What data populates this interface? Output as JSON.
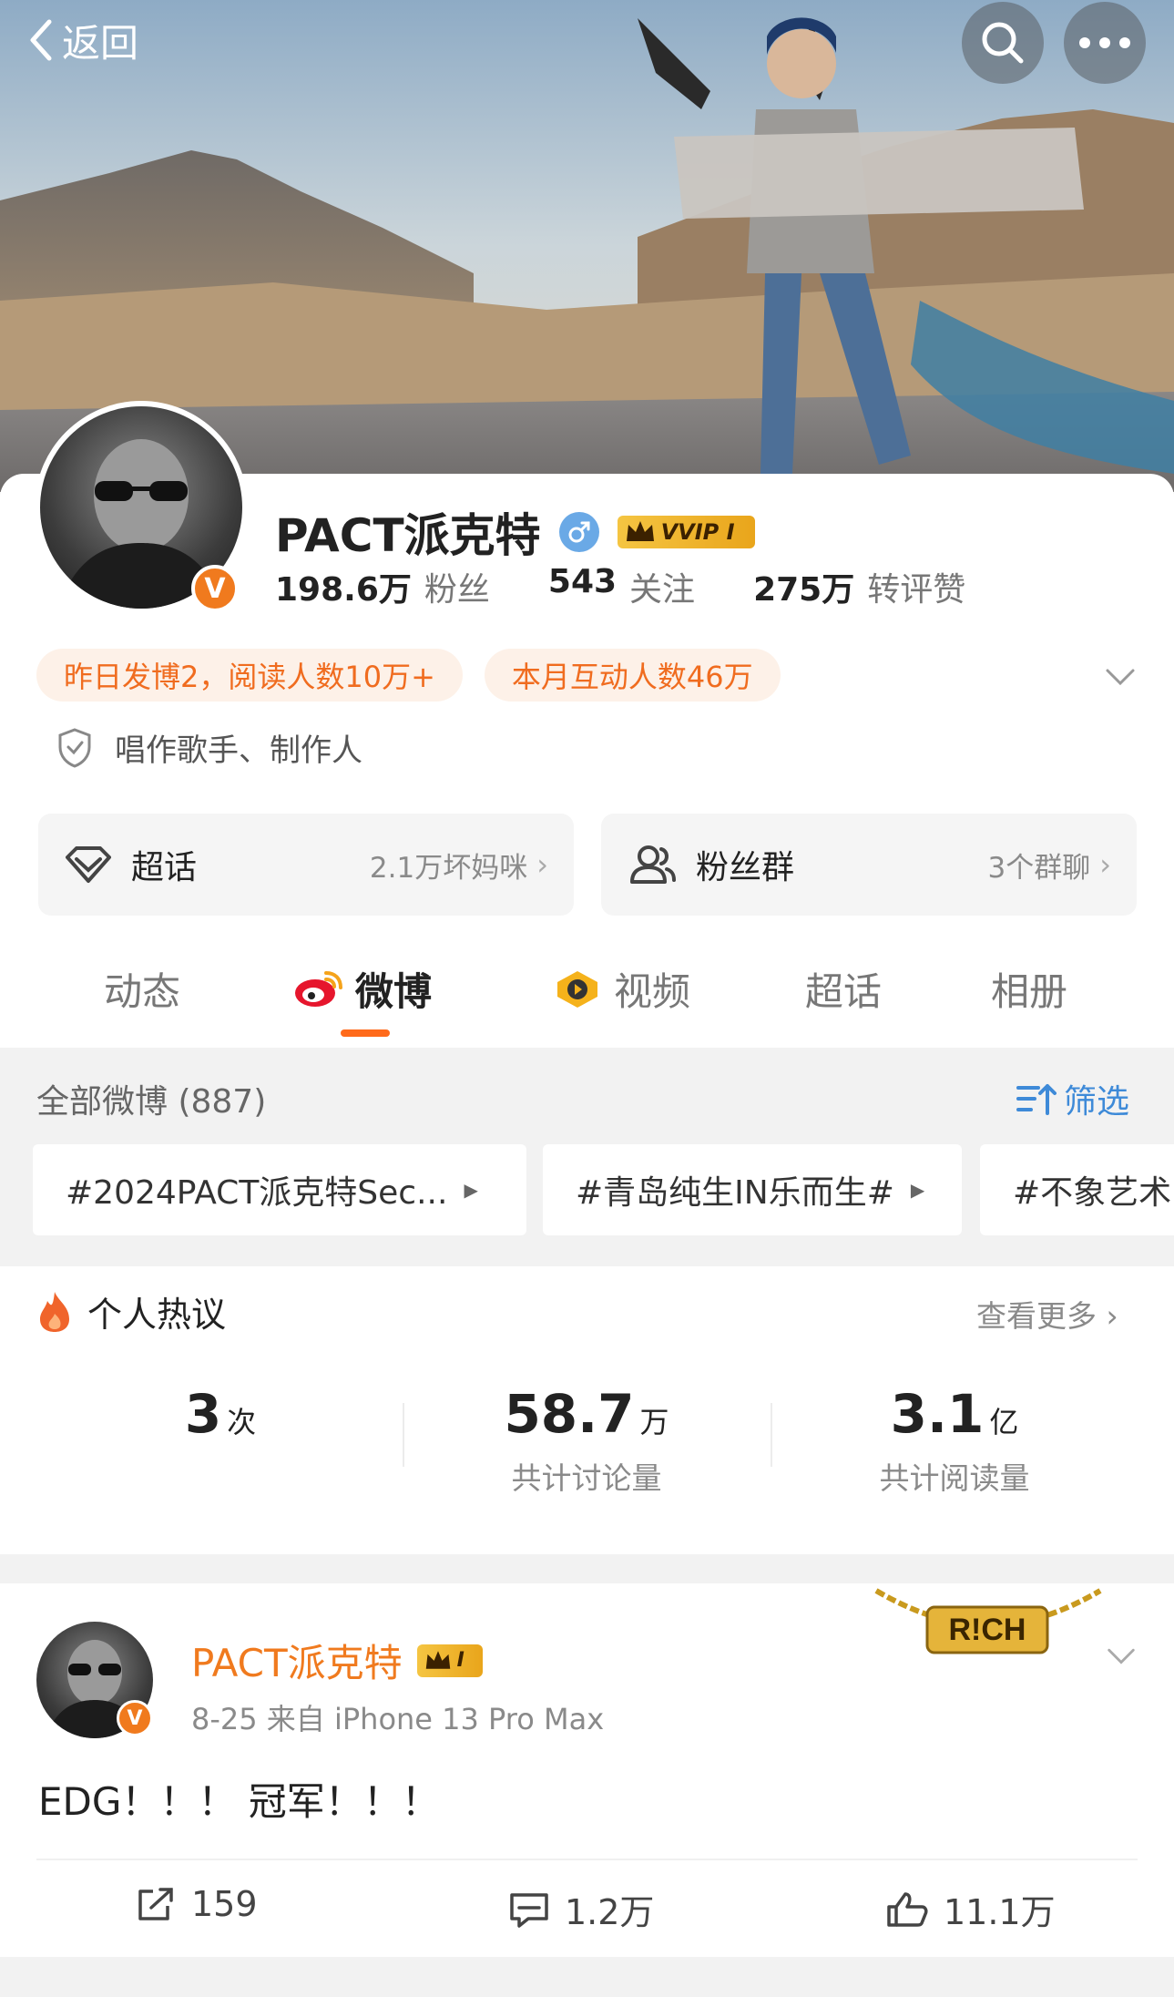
{
  "nav": {
    "back_label": "返回"
  },
  "profile": {
    "name": "PACT派克特",
    "vip_label": "VVIP I",
    "verified_mark": "V",
    "stats": [
      {
        "value": "198.6万",
        "label": "粉丝"
      },
      {
        "value": "543",
        "label": "关注"
      },
      {
        "value": "275万",
        "label": "转评赞"
      }
    ],
    "chips": [
      "昨日发博2，阅读人数10万+",
      "本月互动人数46万"
    ],
    "verification": "唱作歌手、制作人"
  },
  "features": [
    {
      "title": "超话",
      "meta": "2.1万坏妈咪"
    },
    {
      "title": "粉丝群",
      "meta": "3个群聊"
    }
  ],
  "tabs": [
    {
      "label": "动态"
    },
    {
      "label": "微博"
    },
    {
      "label": "视频"
    },
    {
      "label": "超话"
    },
    {
      "label": "相册"
    }
  ],
  "all_posts": {
    "title": "全部微博 (887)",
    "filter_label": "筛选",
    "topics": [
      "#2024PACT派克特Sec...",
      "#青岛纯生IN乐而生#",
      "#不象艺术"
    ]
  },
  "hot": {
    "title": "个人热议",
    "more": "查看更多",
    "metrics": [
      {
        "value": "3",
        "unit": "次",
        "label": ""
      },
      {
        "value": "58.7",
        "unit": "万",
        "label": "共计讨论量"
      },
      {
        "value": "3.1",
        "unit": "亿",
        "label": "共计阅读量"
      }
    ]
  },
  "post": {
    "author": "PACT派克特",
    "vip_label": "I",
    "decor_text": "R!CH",
    "meta": "8-25  来自 iPhone 13 Pro Max",
    "text": "EDG！！！ 冠军！！！",
    "actions": {
      "repost": "159",
      "comment": "1.2万",
      "like": "11.1万"
    }
  },
  "colors": {
    "accent": "#f07a1e",
    "link": "#3e8ad8",
    "tab_indicator": "#ff6a1a"
  },
  "icons": [
    "back-chevron-icon",
    "search-icon",
    "more-icon",
    "gender-male-icon",
    "shield-icon",
    "chevron-down-icon",
    "diamond-icon",
    "group-icon",
    "weibo-logo-icon",
    "video-icon",
    "filter-icon",
    "fire-icon",
    "repost-icon",
    "comment-icon",
    "like-icon"
  ]
}
